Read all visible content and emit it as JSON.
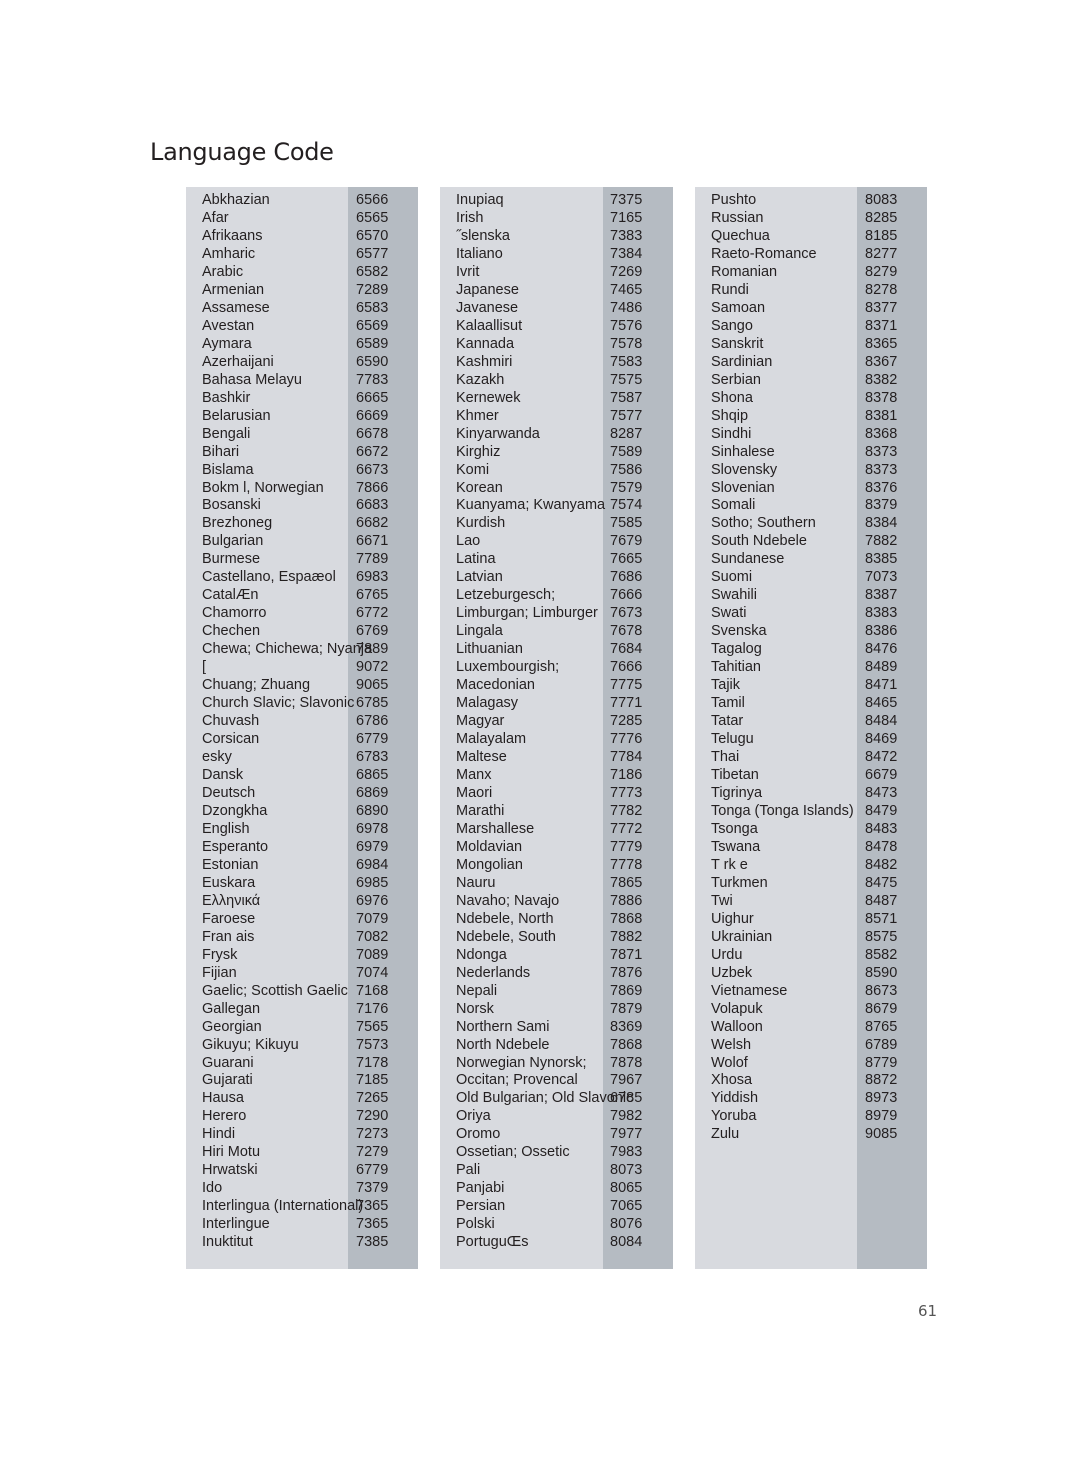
{
  "page": {
    "title": "Language Code",
    "page_number": "61"
  },
  "columns": [
    {
      "rows": [
        {
          "name": "Abkhazian",
          "code": "6566"
        },
        {
          "name": "Afar",
          "code": "6565"
        },
        {
          "name": "Afrikaans",
          "code": "6570"
        },
        {
          "name": "Amharic",
          "code": "6577"
        },
        {
          "name": "Arabic",
          "code": "6582"
        },
        {
          "name": "Armenian",
          "code": "7289"
        },
        {
          "name": "Assamese",
          "code": "6583"
        },
        {
          "name": "Avestan",
          "code": "6569"
        },
        {
          "name": "Aymara",
          "code": "6589"
        },
        {
          "name": "Azerhaijani",
          "code": "6590"
        },
        {
          "name": "Bahasa Melayu",
          "code": "7783"
        },
        {
          "name": "Bashkir",
          "code": "6665"
        },
        {
          "name": "Belarusian",
          "code": "6669"
        },
        {
          "name": "Bengali",
          "code": "6678"
        },
        {
          "name": "Bihari",
          "code": "6672"
        },
        {
          "name": "Bislama",
          "code": "6673"
        },
        {
          "name": "Bokm l, Norwegian",
          "code": "7866"
        },
        {
          "name": "Bosanski",
          "code": "6683"
        },
        {
          "name": "Brezhoneg",
          "code": "6682"
        },
        {
          "name": "Bulgarian",
          "code": "6671"
        },
        {
          "name": "Burmese",
          "code": "7789"
        },
        {
          "name": "Castellano, Espaæol",
          "code": "6983"
        },
        {
          "name": "CatalÆn",
          "code": "6765"
        },
        {
          "name": "Chamorro",
          "code": "6772"
        },
        {
          "name": "Chechen",
          "code": "6769"
        },
        {
          "name": "Chewa; Chichewa; Nyanja",
          "code": "7889"
        },
        {
          "name": " [",
          "code": "9072"
        },
        {
          "name": "Chuang; Zhuang",
          "code": "9065"
        },
        {
          "name": "Church Slavic; Slavonic",
          "code": "6785"
        },
        {
          "name": "Chuvash",
          "code": "6786"
        },
        {
          "name": "Corsican",
          "code": "6779"
        },
        {
          "name": " esky",
          "code": "6783"
        },
        {
          "name": "Dansk",
          "code": "6865"
        },
        {
          "name": "Deutsch",
          "code": "6869"
        },
        {
          "name": "Dzongkha",
          "code": "6890"
        },
        {
          "name": "English",
          "code": "6978"
        },
        {
          "name": "Esperanto",
          "code": "6979"
        },
        {
          "name": "Estonian",
          "code": "6984"
        },
        {
          "name": "Euskara",
          "code": "6985"
        },
        {
          "name": "Ελληνικά",
          "code": "6976"
        },
        {
          "name": "Faroese",
          "code": "7079"
        },
        {
          "name": "Fran ais",
          "code": "7082"
        },
        {
          "name": "Frysk",
          "code": "7089"
        },
        {
          "name": "Fijian",
          "code": "7074"
        },
        {
          "name": "Gaelic; Scottish Gaelic",
          "code": "7168"
        },
        {
          "name": "Gallegan",
          "code": "7176"
        },
        {
          "name": "Georgian",
          "code": "7565"
        },
        {
          "name": "Gikuyu; Kikuyu",
          "code": "7573"
        },
        {
          "name": "Guarani",
          "code": "7178"
        },
        {
          "name": "Gujarati",
          "code": "7185"
        },
        {
          "name": "Hausa",
          "code": "7265"
        },
        {
          "name": "Herero",
          "code": "7290"
        },
        {
          "name": "Hindi",
          "code": "7273"
        },
        {
          "name": "Hiri Motu",
          "code": "7279"
        },
        {
          "name": "Hrwatski",
          "code": "6779"
        },
        {
          "name": "Ido",
          "code": "7379"
        },
        {
          "name": "Interlingua (International)",
          "code": "7365"
        },
        {
          "name": "Interlingue",
          "code": "7365"
        },
        {
          "name": "Inuktitut",
          "code": "7385"
        }
      ]
    },
    {
      "rows": [
        {
          "name": "Inupiaq",
          "code": "7375"
        },
        {
          "name": "Irish",
          "code": "7165"
        },
        {
          "name": "˝slenska",
          "code": "7383"
        },
        {
          "name": "Italiano",
          "code": "7384"
        },
        {
          "name": "Ivrit",
          "code": "7269"
        },
        {
          "name": "Japanese",
          "code": "7465"
        },
        {
          "name": "Javanese",
          "code": "7486"
        },
        {
          "name": "Kalaallisut",
          "code": "7576"
        },
        {
          "name": "Kannada",
          "code": "7578"
        },
        {
          "name": "Kashmiri",
          "code": "7583"
        },
        {
          "name": "Kazakh",
          "code": "7575"
        },
        {
          "name": "Kernewek",
          "code": "7587"
        },
        {
          "name": "Khmer",
          "code": "7577"
        },
        {
          "name": "Kinyarwanda",
          "code": "8287"
        },
        {
          "name": "Kirghiz",
          "code": "7589"
        },
        {
          "name": "Komi",
          "code": "7586"
        },
        {
          "name": "Korean",
          "code": "7579"
        },
        {
          "name": "Kuanyama; Kwanyama",
          "code": "7574"
        },
        {
          "name": "Kurdish",
          "code": "7585"
        },
        {
          "name": "Lao",
          "code": "7679"
        },
        {
          "name": "Latina",
          "code": "7665"
        },
        {
          "name": "Latvian",
          "code": "7686"
        },
        {
          "name": "Letzeburgesch;",
          "code": "7666"
        },
        {
          "name": "Limburgan; Limburger",
          "code": "7673"
        },
        {
          "name": "Lingala",
          "code": "7678"
        },
        {
          "name": "Lithuanian",
          "code": "7684"
        },
        {
          "name": "Luxembourgish;",
          "code": "7666"
        },
        {
          "name": "Macedonian",
          "code": "7775"
        },
        {
          "name": "Malagasy",
          "code": "7771"
        },
        {
          "name": "Magyar",
          "code": "7285"
        },
        {
          "name": "Malayalam",
          "code": "7776"
        },
        {
          "name": "Maltese",
          "code": "7784"
        },
        {
          "name": "Manx",
          "code": "7186"
        },
        {
          "name": "Maori",
          "code": "7773"
        },
        {
          "name": "Marathi",
          "code": "7782"
        },
        {
          "name": "Marshallese",
          "code": "7772"
        },
        {
          "name": "Moldavian",
          "code": "7779"
        },
        {
          "name": "Mongolian",
          "code": "7778"
        },
        {
          "name": "Nauru",
          "code": "7865"
        },
        {
          "name": "Navaho; Navajo",
          "code": "7886"
        },
        {
          "name": "Ndebele, North",
          "code": "7868"
        },
        {
          "name": "Ndebele, South",
          "code": "7882"
        },
        {
          "name": "Ndonga",
          "code": "7871"
        },
        {
          "name": "Nederlands",
          "code": "7876"
        },
        {
          "name": "Nepali",
          "code": "7869"
        },
        {
          "name": "Norsk",
          "code": "7879"
        },
        {
          "name": "Northern Sami",
          "code": "8369"
        },
        {
          "name": "North Ndebele",
          "code": "7868"
        },
        {
          "name": "Norwegian Nynorsk;",
          "code": "7878"
        },
        {
          "name": "Occitan; Provencal",
          "code": "7967"
        },
        {
          "name": "Old Bulgarian; Old Slavonic",
          "code": "6785"
        },
        {
          "name": "Oriya",
          "code": "7982"
        },
        {
          "name": "Oromo",
          "code": "7977"
        },
        {
          "name": "Ossetian; Ossetic",
          "code": "7983"
        },
        {
          "name": "Pali",
          "code": "8073"
        },
        {
          "name": "Panjabi",
          "code": "8065"
        },
        {
          "name": "Persian",
          "code": "7065"
        },
        {
          "name": "Polski",
          "code": "8076"
        },
        {
          "name": "PortuguŒs",
          "code": "8084"
        }
      ]
    },
    {
      "rows": [
        {
          "name": "Pushto",
          "code": "8083"
        },
        {
          "name": "Russian",
          "code": "8285"
        },
        {
          "name": "Quechua",
          "code": "8185"
        },
        {
          "name": "Raeto-Romance",
          "code": "8277"
        },
        {
          "name": "Romanian",
          "code": "8279"
        },
        {
          "name": "Rundi",
          "code": "8278"
        },
        {
          "name": "Samoan",
          "code": "8377"
        },
        {
          "name": "Sango",
          "code": "8371"
        },
        {
          "name": "Sanskrit",
          "code": "8365"
        },
        {
          "name": "Sardinian",
          "code": "8367"
        },
        {
          "name": "Serbian",
          "code": "8382"
        },
        {
          "name": "Shona",
          "code": "8378"
        },
        {
          "name": "Shqip",
          "code": "8381"
        },
        {
          "name": "Sindhi",
          "code": "8368"
        },
        {
          "name": "Sinhalese",
          "code": "8373"
        },
        {
          "name": "Slovensky",
          "code": "8373"
        },
        {
          "name": "Slovenian",
          "code": "8376"
        },
        {
          "name": "Somali",
          "code": "8379"
        },
        {
          "name": "Sotho; Southern",
          "code": "8384"
        },
        {
          "name": "South Ndebele",
          "code": "7882"
        },
        {
          "name": "Sundanese",
          "code": "8385"
        },
        {
          "name": "Suomi",
          "code": "7073"
        },
        {
          "name": "Swahili",
          "code": "8387"
        },
        {
          "name": "Swati",
          "code": "8383"
        },
        {
          "name": "Svenska",
          "code": "8386"
        },
        {
          "name": "Tagalog",
          "code": "8476"
        },
        {
          "name": "Tahitian",
          "code": "8489"
        },
        {
          "name": "Tajik",
          "code": "8471"
        },
        {
          "name": "Tamil",
          "code": "8465"
        },
        {
          "name": "Tatar",
          "code": "8484"
        },
        {
          "name": "Telugu",
          "code": "8469"
        },
        {
          "name": "Thai",
          "code": "8472"
        },
        {
          "name": "Tibetan",
          "code": "6679"
        },
        {
          "name": "Tigrinya",
          "code": "8473"
        },
        {
          "name": "Tonga (Tonga Islands)",
          "code": "8479"
        },
        {
          "name": "Tsonga",
          "code": "8483"
        },
        {
          "name": "Tswana",
          "code": "8478"
        },
        {
          "name": "T rk e",
          "code": "8482"
        },
        {
          "name": "Turkmen",
          "code": "8475"
        },
        {
          "name": "Twi",
          "code": "8487"
        },
        {
          "name": "Uighur",
          "code": "8571"
        },
        {
          "name": "Ukrainian",
          "code": "8575"
        },
        {
          "name": "Urdu",
          "code": "8582"
        },
        {
          "name": "Uzbek",
          "code": "8590"
        },
        {
          "name": "Vietnamese",
          "code": "8673"
        },
        {
          "name": "Volapuk",
          "code": "8679"
        },
        {
          "name": "Walloon",
          "code": "8765"
        },
        {
          "name": "Welsh",
          "code": "6789"
        },
        {
          "name": "Wolof",
          "code": "8779"
        },
        {
          "name": "Xhosa",
          "code": "8872"
        },
        {
          "name": "Yiddish",
          "code": "8973"
        },
        {
          "name": "Yoruba",
          "code": "8979"
        },
        {
          "name": "Zulu",
          "code": "9085"
        }
      ]
    }
  ]
}
